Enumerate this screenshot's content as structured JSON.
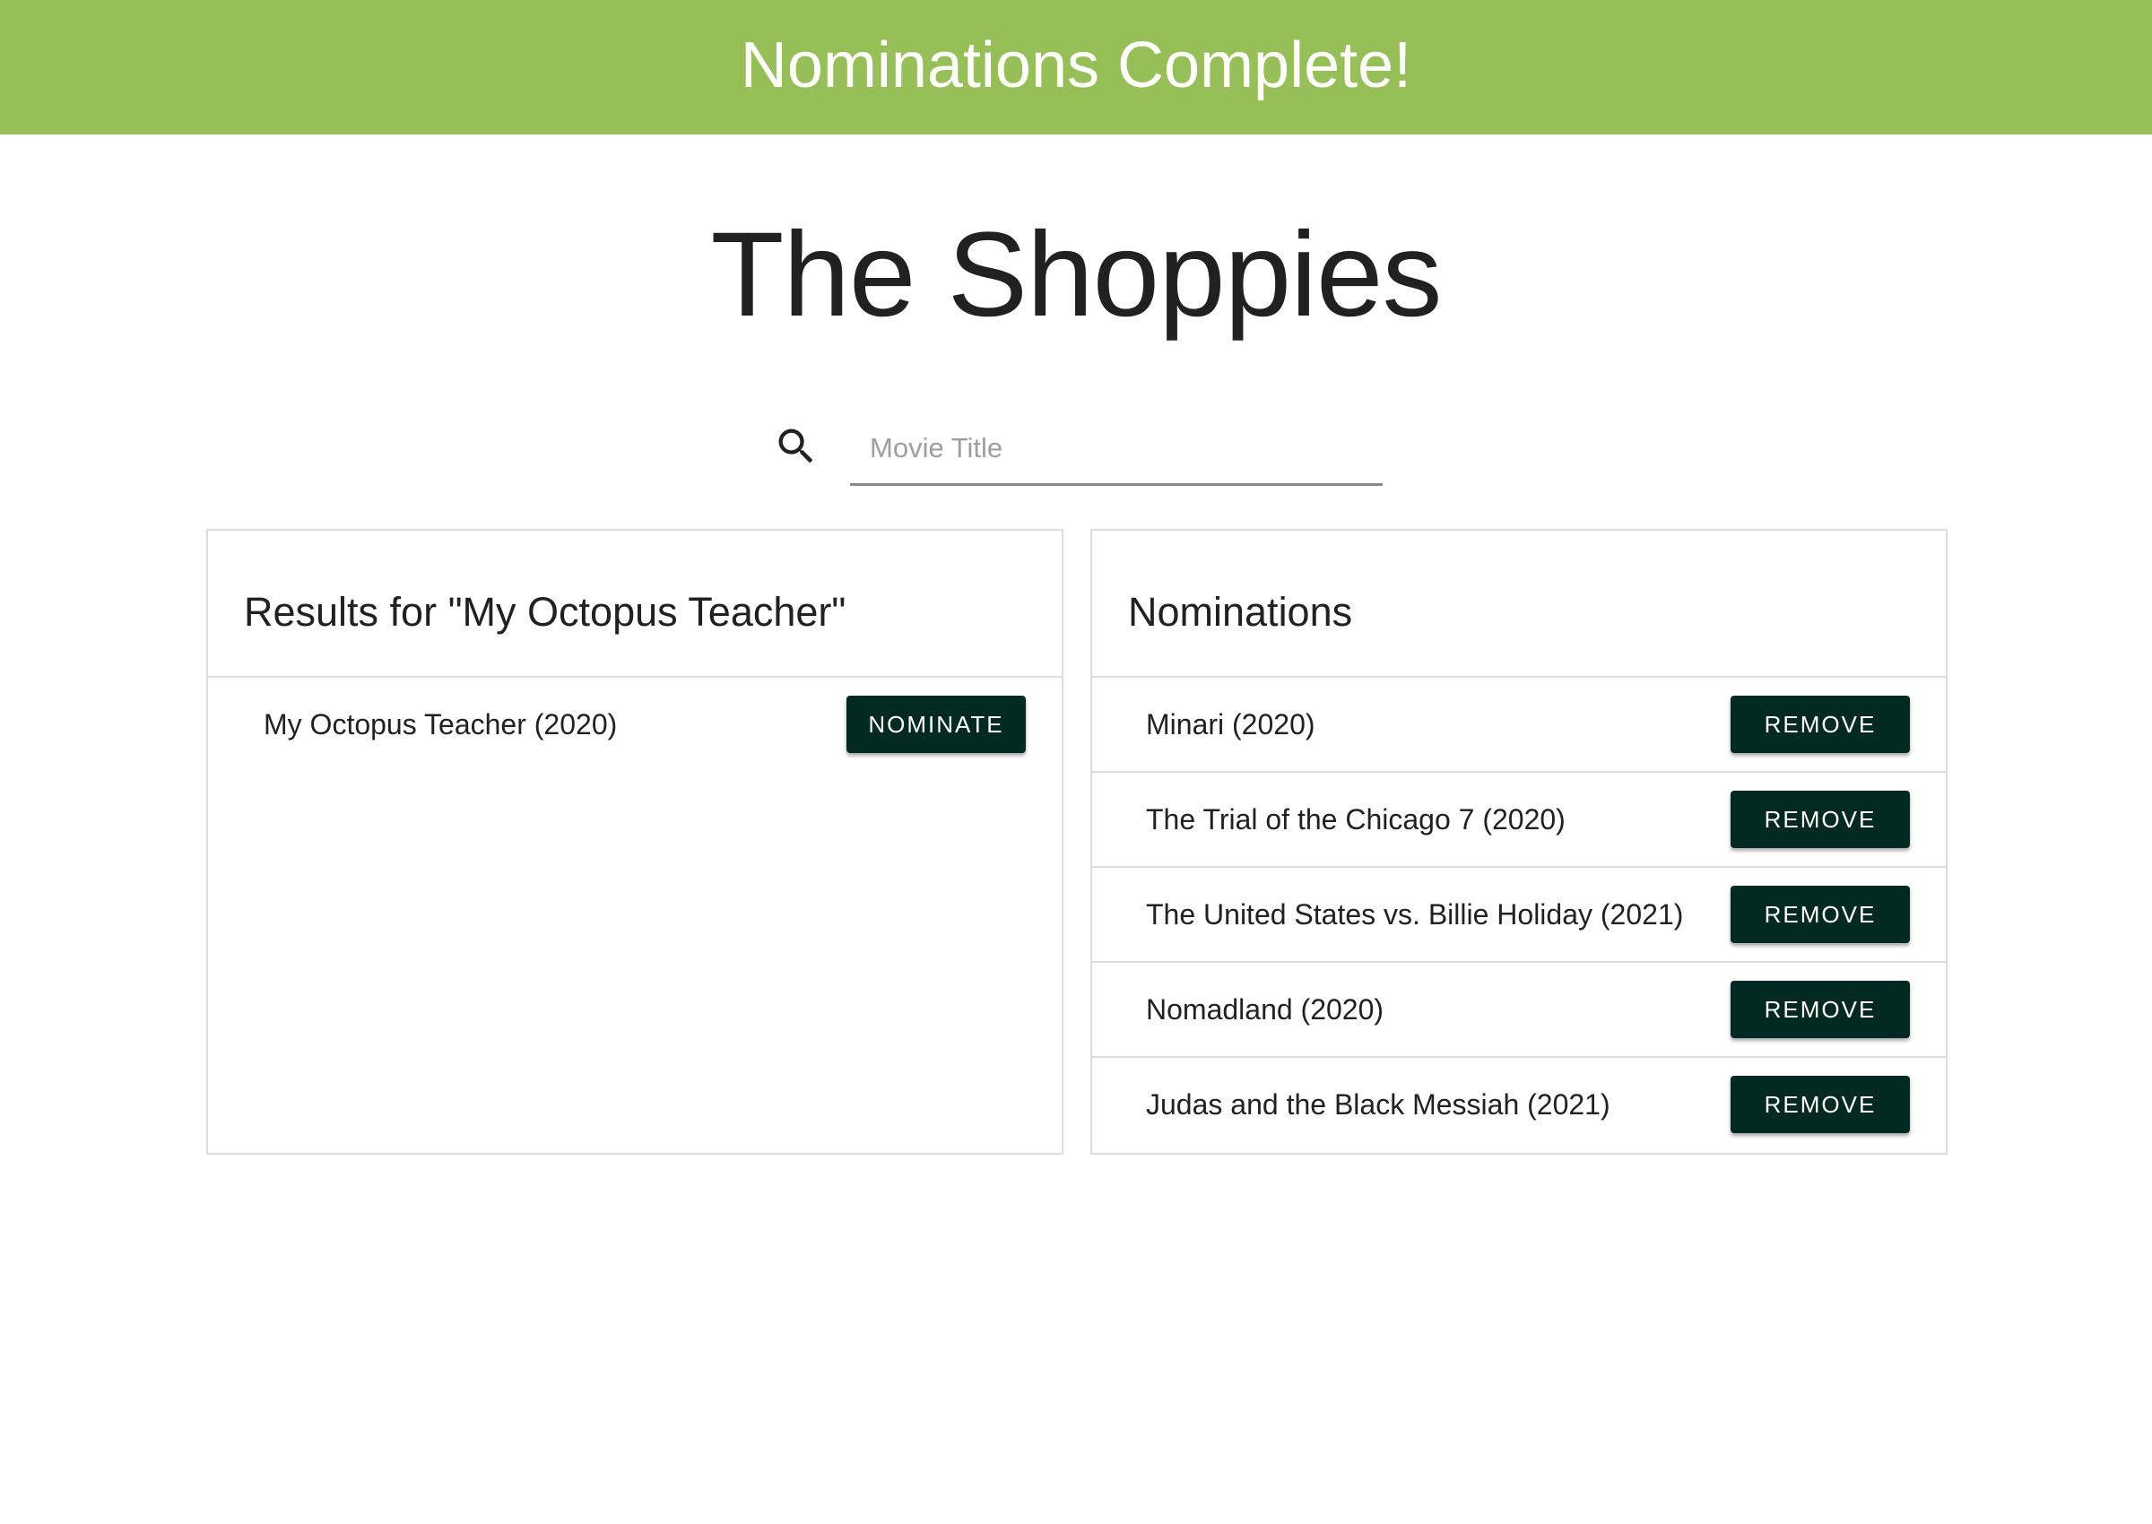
{
  "banner": {
    "text": "Nominations Complete!",
    "color": "#96bf57"
  },
  "page": {
    "title": "The Shoppies"
  },
  "search": {
    "placeholder": "Movie Title",
    "value": "",
    "icon": "search-icon"
  },
  "results": {
    "heading": "Results for \"My Octopus Teacher\"",
    "items": [
      {
        "title": "My Octopus Teacher (2020)",
        "action": "NOMINATE"
      }
    ]
  },
  "nominations": {
    "heading": "Nominations",
    "items": [
      {
        "title": "Minari (2020)",
        "action": "REMOVE"
      },
      {
        "title": "The Trial of the Chicago 7 (2020)",
        "action": "REMOVE"
      },
      {
        "title": "The United States vs. Billie Holiday (2021)",
        "action": "REMOVE"
      },
      {
        "title": "Nomadland (2020)",
        "action": "REMOVE"
      },
      {
        "title": "Judas and the Black Messiah (2021)",
        "action": "REMOVE"
      }
    ]
  },
  "colors": {
    "button": "#032a22",
    "text": "#212121",
    "border": "#dcdcdc"
  }
}
